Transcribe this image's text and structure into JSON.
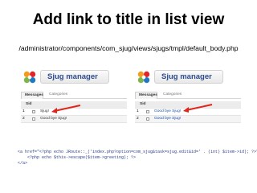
{
  "slide": {
    "title": "Add link to title in list view",
    "path": "/administrator/components/com_sjug/views/sjugs/tmpl/default_body.php"
  },
  "screenshots": [
    {
      "app_title": "Sjug manager",
      "tabs": [
        "Messages",
        "Categories"
      ],
      "table": {
        "header": "Sid",
        "rows": [
          {
            "num": "1",
            "text": "Sjug!"
          },
          {
            "num": "2",
            "text": "Good bye Sjug!"
          }
        ]
      }
    },
    {
      "app_title": "Sjug manager",
      "tabs": [
        "Messages",
        "Categories"
      ],
      "table": {
        "header": "Sid",
        "rows": [
          {
            "num": "1",
            "text": "Good bye Sjug!"
          },
          {
            "num": "2",
            "text": "Good bye Sjug!"
          }
        ]
      }
    }
  ],
  "code_lines": [
    "<a href=\"<?php echo JRoute::_('index.php?option=com_sjug&task=sjug.edit&id=' . (int) $item->id); ?>\">",
    "    <?php echo $this->escape($item->greeting); ?>",
    "</a>"
  ],
  "colors": {
    "arrow": "#e0251b",
    "link": "#1a4ea8",
    "header_text": "#2d4b8f"
  }
}
